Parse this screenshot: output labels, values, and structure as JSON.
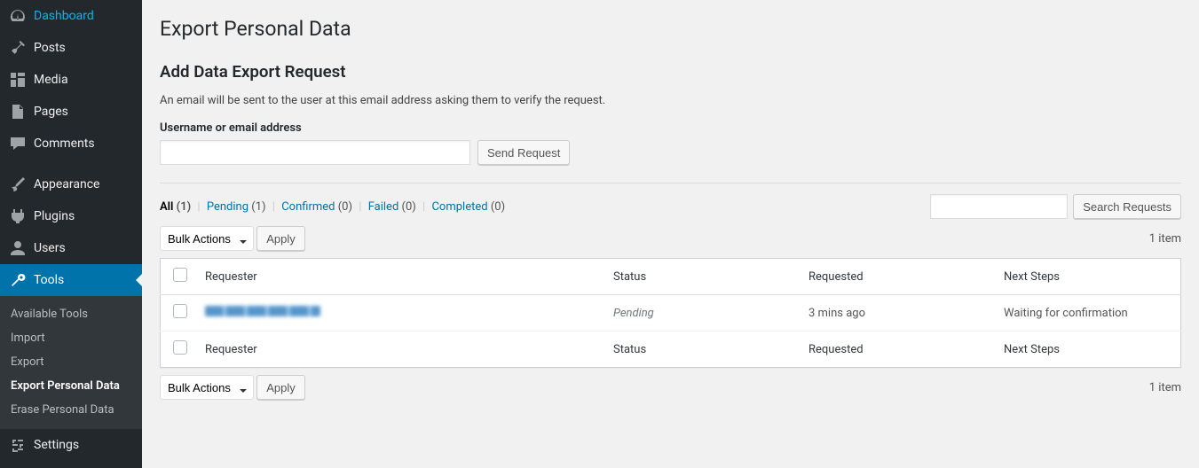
{
  "sidebar": {
    "items": [
      {
        "label": "Dashboard"
      },
      {
        "label": "Posts"
      },
      {
        "label": "Media"
      },
      {
        "label": "Pages"
      },
      {
        "label": "Comments"
      },
      {
        "label": "Appearance"
      },
      {
        "label": "Plugins"
      },
      {
        "label": "Users"
      },
      {
        "label": "Tools"
      },
      {
        "label": "Settings"
      }
    ],
    "submenu": [
      {
        "label": "Available Tools"
      },
      {
        "label": "Import"
      },
      {
        "label": "Export"
      },
      {
        "label": "Export Personal Data"
      },
      {
        "label": "Erase Personal Data"
      }
    ]
  },
  "page": {
    "title": "Export Personal Data",
    "subhead": "Add Data Export Request",
    "helper": "An email will be sent to the user at this email address asking them to verify the request.",
    "field_label": "Username or email address",
    "send_button": "Send Request"
  },
  "filters": {
    "all_label": "All",
    "all_count": "(1)",
    "pending_label": "Pending",
    "pending_count": "(1)",
    "confirmed_label": "Confirmed",
    "confirmed_count": "(0)",
    "failed_label": "Failed",
    "failed_count": "(0)",
    "completed_label": "Completed",
    "completed_count": "(0)"
  },
  "search": {
    "button": "Search Requests"
  },
  "bulk": {
    "option": "Bulk Actions",
    "apply": "Apply"
  },
  "pagination": {
    "count": "1 item"
  },
  "columns": {
    "requester": "Requester",
    "status": "Status",
    "requested": "Requested",
    "next": "Next Steps"
  },
  "rows": [
    {
      "requester": "",
      "status": "Pending",
      "requested": "3 mins ago",
      "next": "Waiting for confirmation"
    }
  ]
}
